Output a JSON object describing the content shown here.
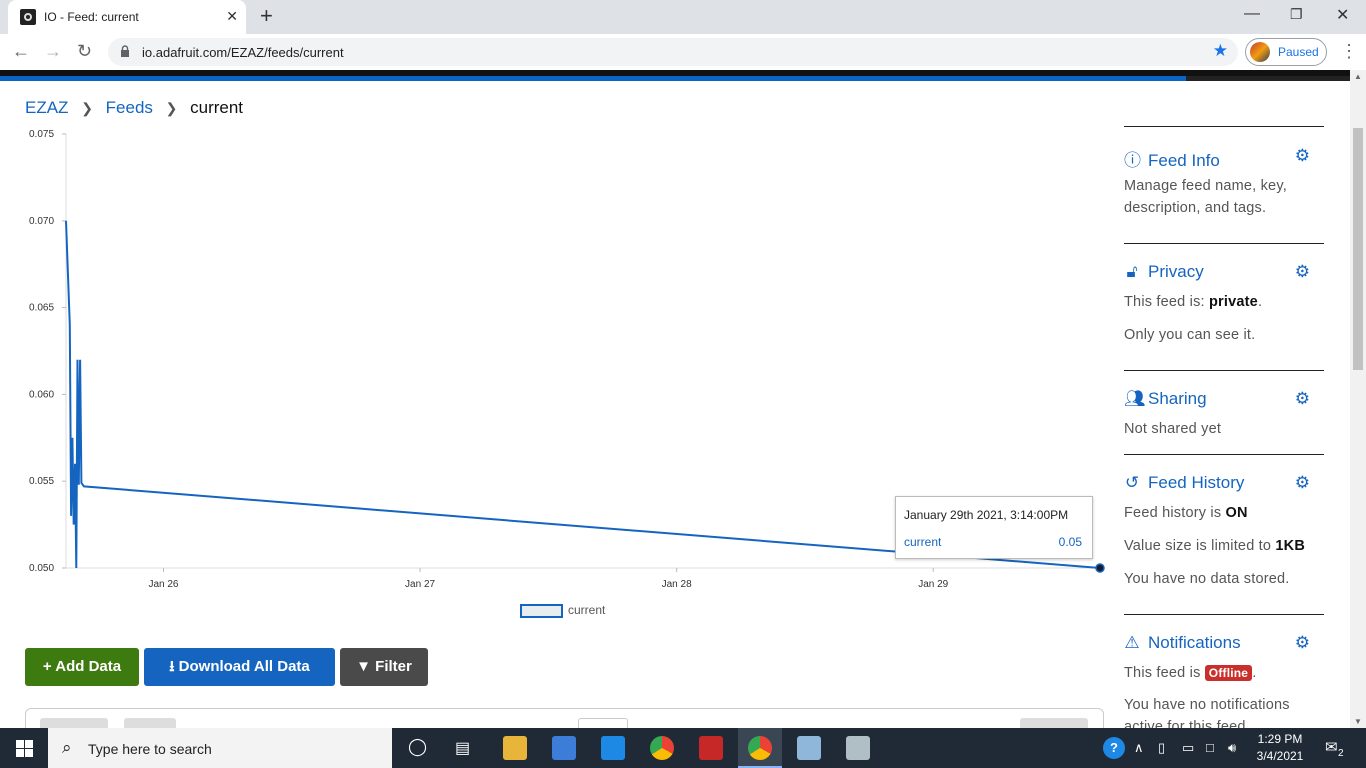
{
  "browser": {
    "tab_title": "IO - Feed: current",
    "tab_close": "✕",
    "new_tab": "+",
    "url": "io.adafruit.com/EZAZ/feeds/current",
    "profile_label": "Paused"
  },
  "breadcrumb": {
    "root": "EZAZ",
    "section": "Feeds",
    "current": "current"
  },
  "chart_data": {
    "type": "line",
    "title": "",
    "xlabel": "",
    "ylabel": "",
    "ylim": [
      0.05,
      0.075
    ],
    "y_ticks": [
      "0.050",
      "0.055",
      "0.060",
      "0.065",
      "0.070",
      "0.075"
    ],
    "x_ticks": [
      "Jan 26",
      "Jan 27",
      "Jan 28",
      "Jan 29"
    ],
    "xlim_days": [
      25.62,
      29.65
    ],
    "series": [
      {
        "name": "current",
        "x": [
          25.62,
          25.635,
          25.64,
          25.645,
          25.65,
          25.655,
          25.66,
          25.665,
          25.67,
          25.675,
          25.68,
          25.685,
          25.69,
          29.65
        ],
        "y": [
          0.07,
          0.064,
          0.053,
          0.0575,
          0.0525,
          0.056,
          0.05,
          0.062,
          0.0548,
          0.062,
          0.0549,
          0.0548,
          0.0547,
          0.05
        ]
      }
    ],
    "legend": [
      "current"
    ],
    "legend_position": "bottom"
  },
  "tooltip": {
    "date": "January 29th 2021, 3:14:00PM",
    "series": "current",
    "value": "0.05"
  },
  "buttons": {
    "add": "+ Add Data",
    "download": "Download All Data",
    "filter": "Filter"
  },
  "sidebar": {
    "feed_info": {
      "title": "Feed Info",
      "text": "Manage feed name, key, description, and tags."
    },
    "privacy": {
      "title": "Privacy",
      "line1_prefix": "This feed is: ",
      "line1_value": "private",
      "line1_suffix": ".",
      "line2": "Only you can see it."
    },
    "sharing": {
      "title": "Sharing",
      "text": "Not shared yet"
    },
    "history": {
      "title": "Feed History",
      "line1_prefix": "Feed history is ",
      "line1_value": "ON",
      "line2_prefix": "Value size is limited to ",
      "line2_value": "1KB",
      "line3": "You have no data stored."
    },
    "notifications": {
      "title": "Notifications",
      "line1_prefix": "This feed is ",
      "badge": "Offline",
      "line1_suffix": ".",
      "line2": "You have no notifications active for this feed."
    }
  },
  "taskbar": {
    "search_placeholder": "Type here to search",
    "time": "1:29 PM",
    "date": "3/4/2021",
    "notification_count": "2"
  },
  "colors": {
    "accent_blue": "#1565c0",
    "add_green": "#3d7a0f",
    "filter_grey": "#4a4a4a",
    "offline_red": "#c9302c",
    "taskbar": "#1f2a36"
  }
}
